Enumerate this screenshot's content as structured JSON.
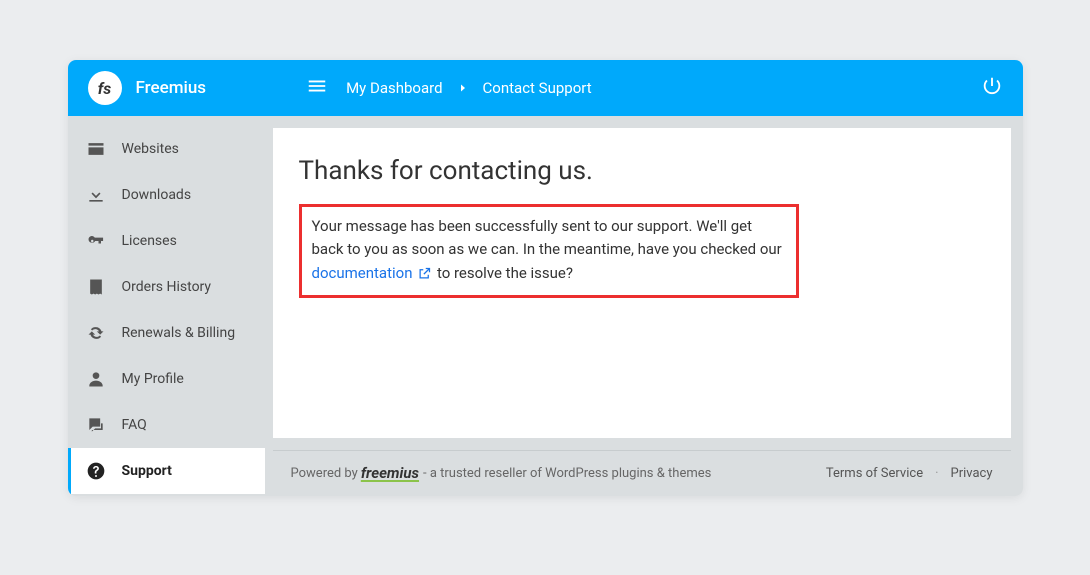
{
  "header": {
    "brand": "Freemius",
    "logo_text": "fs",
    "breadcrumb": {
      "item1": "My Dashboard",
      "item2": "Contact Support"
    }
  },
  "sidebar": {
    "items": [
      {
        "label": "Websites"
      },
      {
        "label": "Downloads"
      },
      {
        "label": "Licenses"
      },
      {
        "label": "Orders History"
      },
      {
        "label": "Renewals & Billing"
      },
      {
        "label": "My Profile"
      },
      {
        "label": "FAQ"
      },
      {
        "label": "Support"
      }
    ]
  },
  "main": {
    "title": "Thanks for contacting us.",
    "message_before": "Your message has been successfully sent to our support. We'll get back to you as soon as we can. In the meantime, have you checked our ",
    "link_text": "documentation",
    "message_after": " to resolve the issue?"
  },
  "footer": {
    "powered_by": "Powered by",
    "brand": "freemius",
    "tagline": " - a trusted reseller of WordPress plugins & themes",
    "tos": "Terms of Service",
    "privacy": "Privacy"
  }
}
